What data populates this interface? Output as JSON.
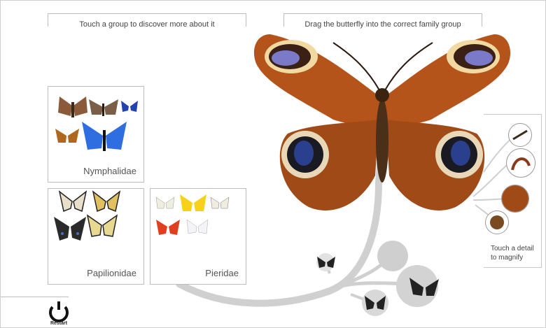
{
  "instructions": {
    "left": "Touch a group to discover more about it",
    "right": "Drag the butterfly into the correct family group"
  },
  "groups": [
    {
      "name": "Nymphalidae"
    },
    {
      "name": "Papilionidae"
    },
    {
      "name": "Pieridae"
    }
  ],
  "details": {
    "hint": "Touch a detail to magnify"
  },
  "restart": {
    "label": "Restart"
  },
  "colors": {
    "border": "#bdbdbd",
    "branch": "#c8c8c8",
    "wing_orange": "#b5541a",
    "eyespot_blue": "#2b3f8f"
  }
}
